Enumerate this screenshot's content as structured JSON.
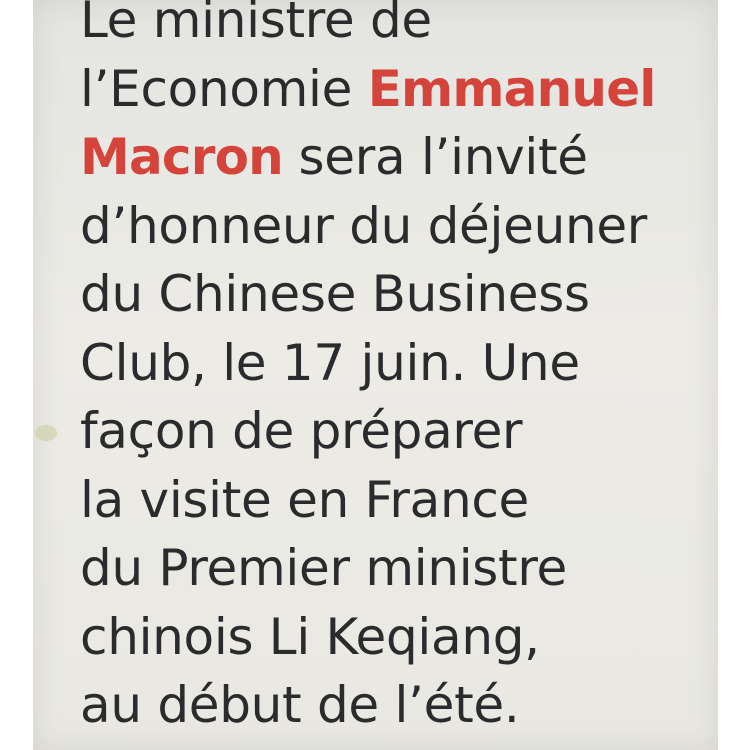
{
  "article": {
    "lines": [
      {
        "text": "Le ministre de"
      },
      {
        "before": "l’Economie ",
        "highlight": "Emmanuel"
      },
      {
        "highlight": "Macron",
        "after": " sera l’invité"
      },
      {
        "text": "d’honneur du déjeuner"
      },
      {
        "text": "du Chinese Business"
      },
      {
        "text": "Club, le 17 juin. Une"
      },
      {
        "text": "façon de préparer"
      },
      {
        "text": "la visite en France"
      },
      {
        "text": "du Premier ministre"
      },
      {
        "text": "chinois Li Keqiang,"
      },
      {
        "text": "au début de l’été."
      }
    ]
  },
  "colors": {
    "paper": "#e8e8e3",
    "text": "#2b2b2d",
    "highlight": "#d5443b",
    "background": "#ffffff"
  }
}
